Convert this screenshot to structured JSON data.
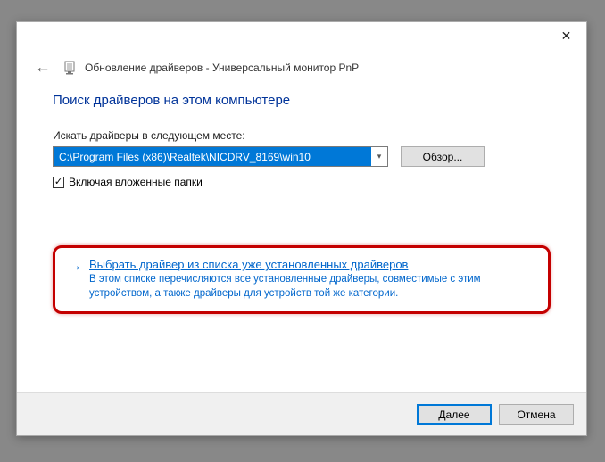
{
  "titlebar": {
    "close": "✕"
  },
  "header": {
    "back": "←",
    "title": "Обновление драйверов - Универсальный монитор PnP"
  },
  "main": {
    "heading": "Поиск драйверов на этом компьютере",
    "path_label": "Искать драйверы в следующем месте:",
    "path_value": "C:\\Program Files (x86)\\Realtek\\NICDRV_8169\\win10",
    "browse_label": "Обзор...",
    "checkbox_checked": "✓",
    "checkbox_label": "Включая вложенные папки"
  },
  "option": {
    "arrow": "→",
    "title": "Выбрать драйвер из списка уже установленных драйверов",
    "desc": "В этом списке перечисляются все установленные драйверы, совместимые с этим устройством, а также драйверы для устройств той же категории."
  },
  "footer": {
    "next": "Далее",
    "cancel": "Отмена"
  }
}
